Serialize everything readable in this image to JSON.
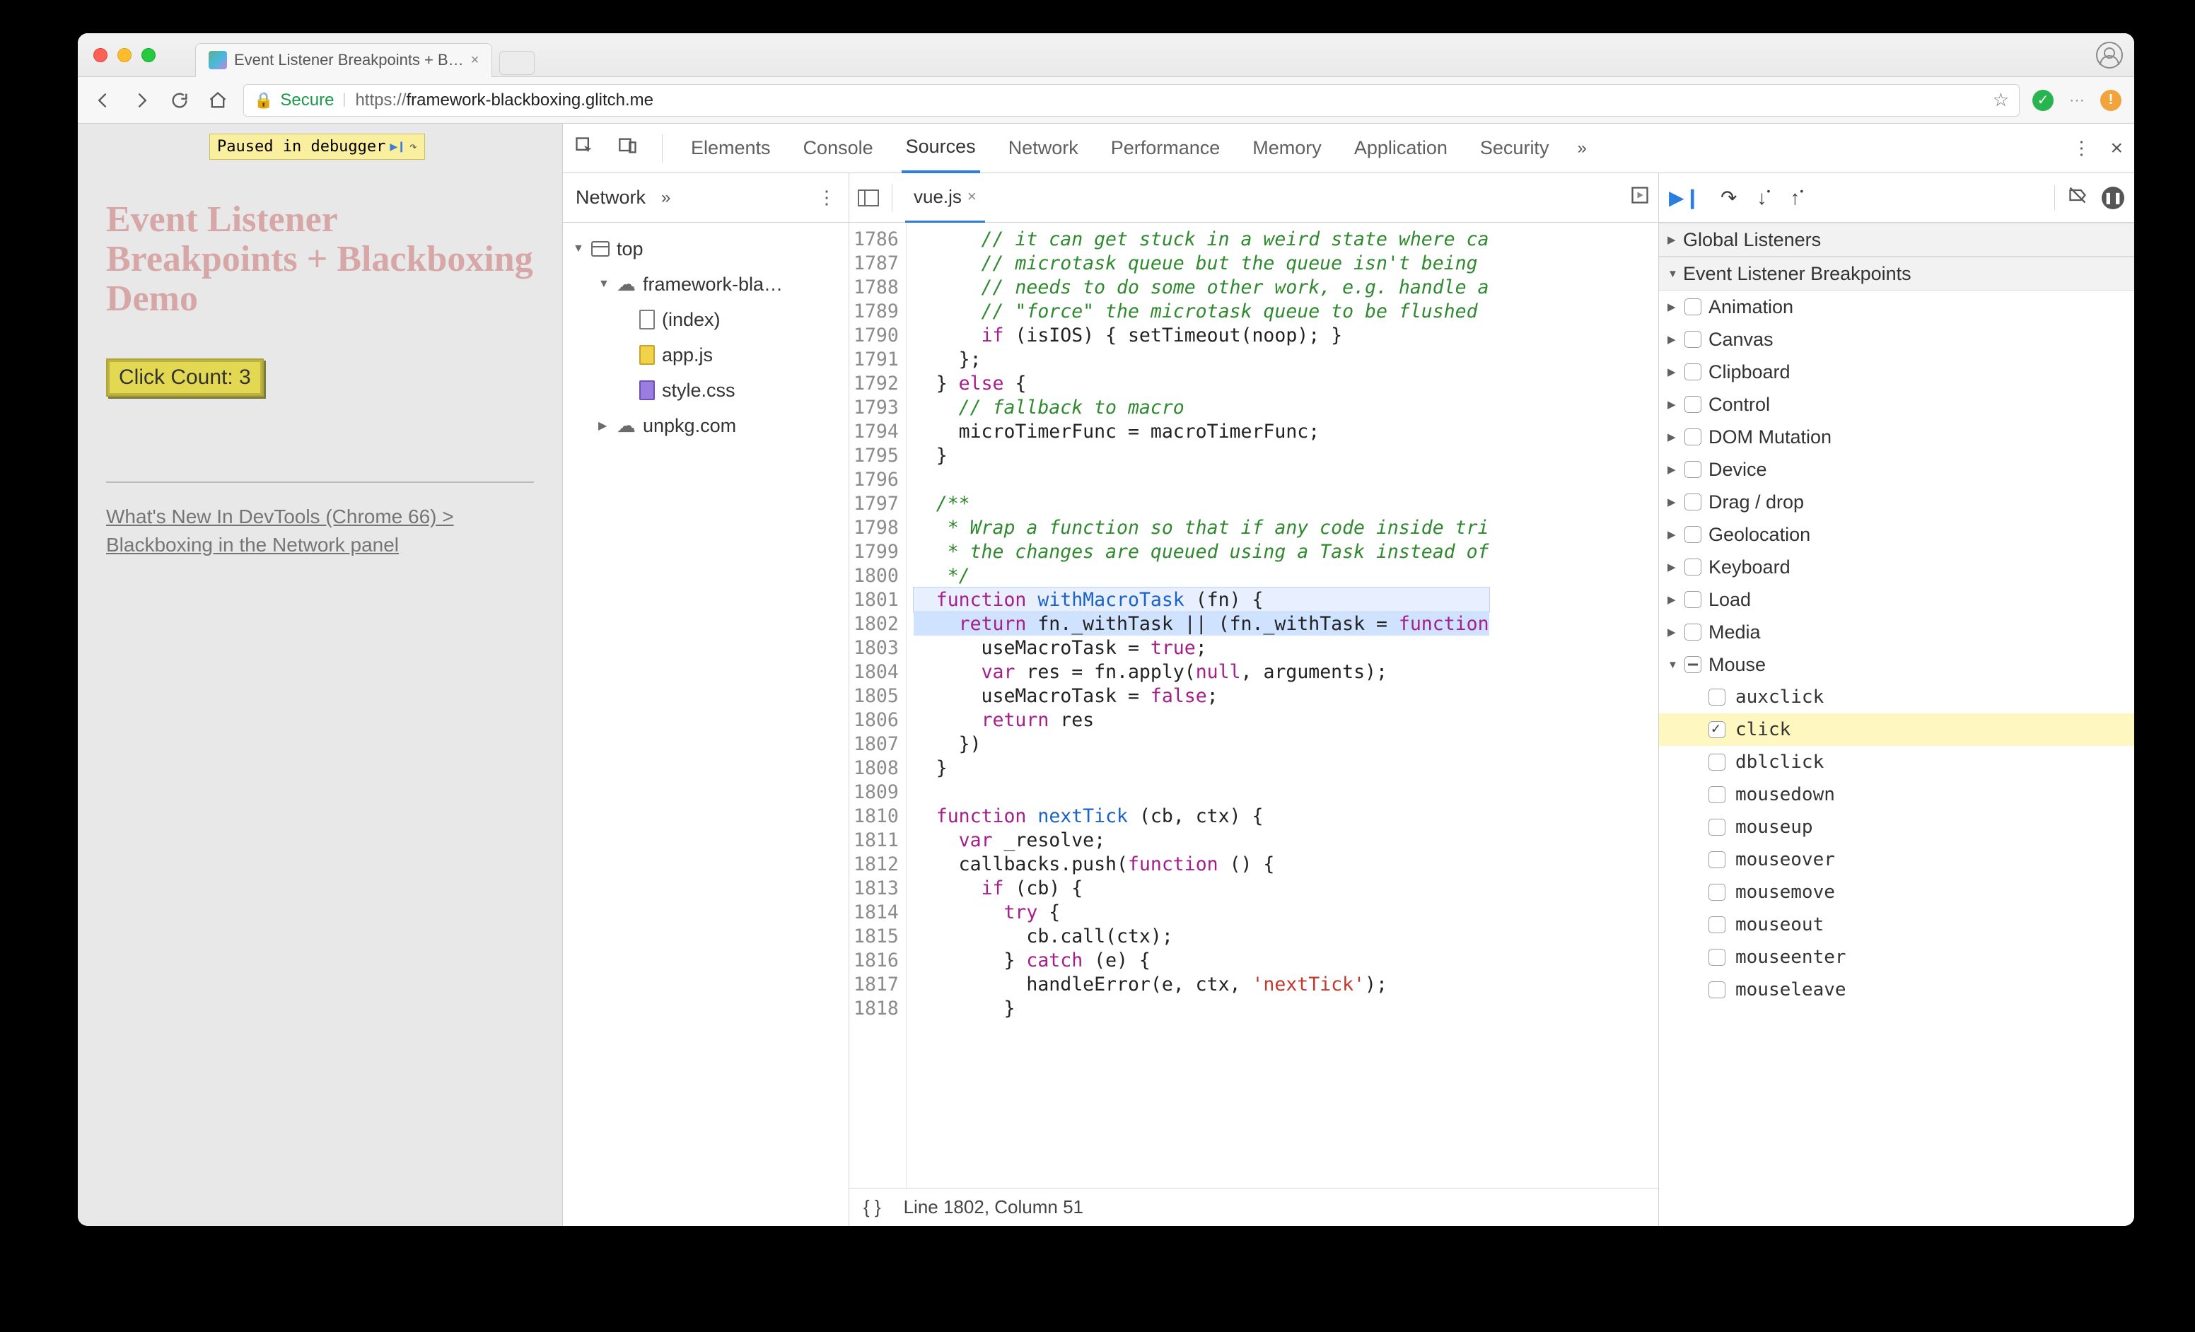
{
  "browser": {
    "tab_title": "Event Listener Breakpoints + B…",
    "secure_label": "Secure",
    "url_scheme_host": "https://framework-blackboxing.glitch.me",
    "url_display_prefix": "https://",
    "url_display_host": "framework-blackboxing.glitch.me"
  },
  "page": {
    "paused_label": "Paused in debugger",
    "headline": "Event Listener Breakpoints + Blackboxing Demo",
    "click_label": "Click Count: 3",
    "link_text": "What's New In DevTools (Chrome 66) > Blackboxing in the Network panel"
  },
  "devtools": {
    "panels": [
      "Elements",
      "Console",
      "Sources",
      "Network",
      "Performance",
      "Memory",
      "Application",
      "Security"
    ],
    "active_panel": "Sources",
    "nav_panel_tab": "Network",
    "tree": {
      "top": "top",
      "origin1": "framework-bla…",
      "files": [
        "(index)",
        "app.js",
        "style.css"
      ],
      "origin2": "unpkg.com"
    },
    "open_file": "vue.js",
    "gutter_start": 1786,
    "gutter_end": 1818,
    "status": "Line 1802, Column 51",
    "code_lines": [
      {
        "n": 1786,
        "t": "      // it can get stuck in a weird state where ca",
        "cls": "com"
      },
      {
        "n": 1787,
        "t": "      // microtask queue but the queue isn't being",
        "cls": "com"
      },
      {
        "n": 1788,
        "t": "      // needs to do some other work, e.g. handle a",
        "cls": "com"
      },
      {
        "n": 1789,
        "t": "      // \"force\" the microtask queue to be flushed",
        "cls": "com"
      },
      {
        "n": 1790,
        "t": "      if (isIOS) { setTimeout(noop); }",
        "cls": "mix1"
      },
      {
        "n": 1791,
        "t": "    };",
        "cls": "plain"
      },
      {
        "n": 1792,
        "t": "  } else {",
        "cls": "mix2"
      },
      {
        "n": 1793,
        "t": "    // fallback to macro",
        "cls": "com"
      },
      {
        "n": 1794,
        "t": "    microTimerFunc = macroTimerFunc;",
        "cls": "plain"
      },
      {
        "n": 1795,
        "t": "  }",
        "cls": "plain"
      },
      {
        "n": 1796,
        "t": "",
        "cls": "plain"
      },
      {
        "n": 1797,
        "t": "  /**",
        "cls": "com"
      },
      {
        "n": 1798,
        "t": "   * Wrap a function so that if any code inside tri",
        "cls": "com"
      },
      {
        "n": 1799,
        "t": "   * the changes are queued using a Task instead of",
        "cls": "com"
      },
      {
        "n": 1800,
        "t": "   */",
        "cls": "com"
      },
      {
        "n": 1801,
        "t": "  function withMacroTask (fn) {",
        "cls": "fndef",
        "hl": "line"
      },
      {
        "n": 1802,
        "t": "    return fn._withTask || (fn._withTask = function",
        "cls": "ret",
        "hl": "exec"
      },
      {
        "n": 1803,
        "t": "      useMacroTask = true;",
        "cls": "assign"
      },
      {
        "n": 1804,
        "t": "      var res = fn.apply(null, arguments);",
        "cls": "var1"
      },
      {
        "n": 1805,
        "t": "      useMacroTask = false;",
        "cls": "assign2"
      },
      {
        "n": 1806,
        "t": "      return res",
        "cls": "ret2"
      },
      {
        "n": 1807,
        "t": "    })",
        "cls": "plain"
      },
      {
        "n": 1808,
        "t": "  }",
        "cls": "plain"
      },
      {
        "n": 1809,
        "t": "",
        "cls": "plain"
      },
      {
        "n": 1810,
        "t": "  function nextTick (cb, ctx) {",
        "cls": "fndef2"
      },
      {
        "n": 1811,
        "t": "    var _resolve;",
        "cls": "var2"
      },
      {
        "n": 1812,
        "t": "    callbacks.push(function () {",
        "cls": "push"
      },
      {
        "n": 1813,
        "t": "      if (cb) {",
        "cls": "if1"
      },
      {
        "n": 1814,
        "t": "        try {",
        "cls": "try"
      },
      {
        "n": 1815,
        "t": "          cb.call(ctx);",
        "cls": "plain"
      },
      {
        "n": 1816,
        "t": "        } catch (e) {",
        "cls": "catch"
      },
      {
        "n": 1817,
        "t": "          handleError(e, ctx, 'nextTick');",
        "cls": "err"
      },
      {
        "n": 1818,
        "t": "        }",
        "cls": "plain"
      }
    ],
    "sidebar": {
      "sections": [
        "Global Listeners",
        "Event Listener Breakpoints"
      ],
      "categories": [
        "Animation",
        "Canvas",
        "Clipboard",
        "Control",
        "DOM Mutation",
        "Device",
        "Drag / drop",
        "Geolocation",
        "Keyboard",
        "Load",
        "Media"
      ],
      "mouse_label": "Mouse",
      "mouse_events": [
        "auxclick",
        "click",
        "dblclick",
        "mousedown",
        "mouseup",
        "mouseover",
        "mousemove",
        "mouseout",
        "mouseenter",
        "mouseleave"
      ],
      "mouse_checked": "click"
    }
  }
}
